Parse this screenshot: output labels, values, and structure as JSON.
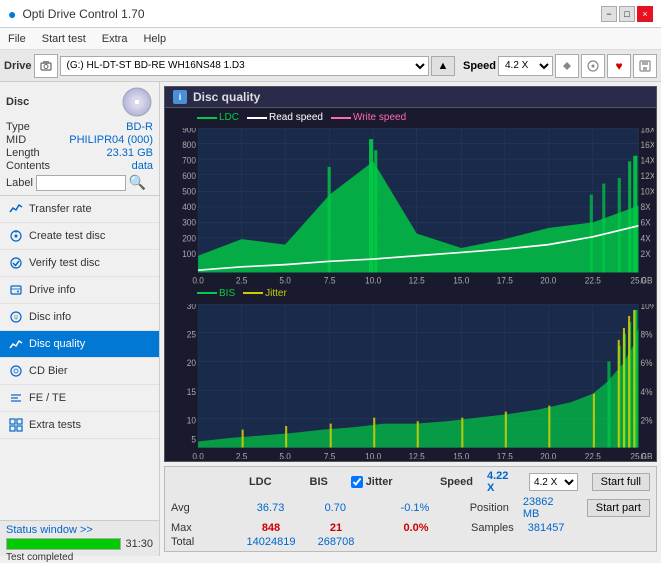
{
  "app": {
    "title": "Opti Drive Control 1.70",
    "min_label": "−",
    "max_label": "□",
    "close_label": "×"
  },
  "menu": {
    "items": [
      "File",
      "Start test",
      "Extra",
      "Help"
    ]
  },
  "drive_toolbar": {
    "label": "Drive",
    "drive_value": "(G:)  HL-DT-ST BD-RE  WH16NS48 1.D3",
    "speed_label": "Speed",
    "speed_value": "4.2 X"
  },
  "disc": {
    "header": "Disc",
    "type_label": "Type",
    "type_value": "BD-R",
    "mid_label": "MID",
    "mid_value": "PHILIPR04 (000)",
    "length_label": "Length",
    "length_value": "23.31 GB",
    "contents_label": "Contents",
    "contents_value": "data",
    "label_label": "Label",
    "label_value": ""
  },
  "nav": {
    "items": [
      {
        "id": "transfer-rate",
        "label": "Transfer rate",
        "icon": "chart"
      },
      {
        "id": "create-test-disc",
        "label": "Create test disc",
        "icon": "disc"
      },
      {
        "id": "verify-test-disc",
        "label": "Verify test disc",
        "icon": "check"
      },
      {
        "id": "drive-info",
        "label": "Drive info",
        "icon": "info"
      },
      {
        "id": "disc-info",
        "label": "Disc info",
        "icon": "disc-info"
      },
      {
        "id": "disc-quality",
        "label": "Disc quality",
        "icon": "quality",
        "active": true
      },
      {
        "id": "cd-bier",
        "label": "CD Bier",
        "icon": "cd"
      },
      {
        "id": "fe-te",
        "label": "FE / TE",
        "icon": "fe"
      },
      {
        "id": "extra-tests",
        "label": "Extra tests",
        "icon": "extra"
      }
    ]
  },
  "status": {
    "window_btn": "Status window >>",
    "progress_pct": 100,
    "progress_label": "Test completed",
    "time": "31:30"
  },
  "quality": {
    "title": "Disc quality",
    "icon_label": "i",
    "legend": {
      "ldc": "LDC",
      "read_speed": "Read speed",
      "write_speed": "Write speed",
      "bis": "BIS",
      "jitter": "Jitter"
    },
    "chart1": {
      "y_max": 900,
      "y_right_max": 18,
      "x_max": 25,
      "labels_x": [
        "0.0",
        "2.5",
        "5.0",
        "7.5",
        "10.0",
        "12.5",
        "15.0",
        "17.5",
        "20.0",
        "22.5",
        "25.0"
      ],
      "labels_y_left": [
        "900",
        "800",
        "700",
        "600",
        "500",
        "400",
        "300",
        "200",
        "100"
      ],
      "labels_y_right": [
        "18X",
        "16X",
        "14X",
        "12X",
        "10X",
        "8X",
        "6X",
        "4X",
        "2X"
      ]
    },
    "chart2": {
      "y_max": 30,
      "y_right_max": 10,
      "x_max": 25,
      "labels_x": [
        "0.0",
        "2.5",
        "5.0",
        "7.5",
        "10.0",
        "12.5",
        "15.0",
        "17.5",
        "20.0",
        "22.5",
        "25.0"
      ],
      "labels_y_left": [
        "30",
        "25",
        "20",
        "15",
        "10",
        "5"
      ],
      "labels_y_right": [
        "10%",
        "8%",
        "6%",
        "4%",
        "2%"
      ]
    }
  },
  "stats": {
    "col_ldc": "LDC",
    "col_bis": "BIS",
    "col_jitter": "Jitter",
    "col_speed": "Speed",
    "avg_label": "Avg",
    "avg_ldc": "36.73",
    "avg_bis": "0.70",
    "avg_jitter": "-0.1%",
    "max_label": "Max",
    "max_ldc": "848",
    "max_bis": "21",
    "max_jitter": "0.0%",
    "total_label": "Total",
    "total_ldc": "14024819",
    "total_bis": "268708",
    "speed_value": "4.22 X",
    "position_label": "Position",
    "position_value": "23862 MB",
    "samples_label": "Samples",
    "samples_value": "381457",
    "speed_select": "4.2 X",
    "start_full": "Start full",
    "start_part": "Start part",
    "jitter_checked": true
  },
  "colors": {
    "ldc_line": "#00cc44",
    "read_speed_line": "#ffffff",
    "write_speed_line": "#ff69b4",
    "bis_line": "#00cc44",
    "jitter_line": "#cccc00",
    "chart_bg": "#1a2a4a",
    "chart_grid": "#2a3a5a",
    "accent": "#0078d4"
  }
}
